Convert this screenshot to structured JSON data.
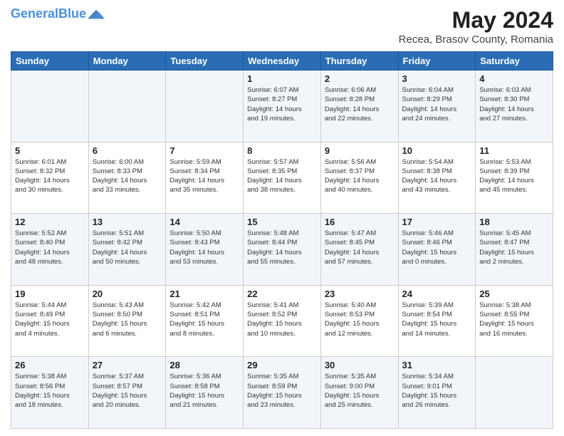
{
  "header": {
    "logo_line1": "General",
    "logo_line2": "Blue",
    "title": "May 2024",
    "subtitle": "Recea, Brasov County, Romania"
  },
  "days_of_week": [
    "Sunday",
    "Monday",
    "Tuesday",
    "Wednesday",
    "Thursday",
    "Friday",
    "Saturday"
  ],
  "weeks": [
    [
      {
        "day": "",
        "info": ""
      },
      {
        "day": "",
        "info": ""
      },
      {
        "day": "",
        "info": ""
      },
      {
        "day": "1",
        "info": "Sunrise: 6:07 AM\nSunset: 8:27 PM\nDaylight: 14 hours\nand 19 minutes."
      },
      {
        "day": "2",
        "info": "Sunrise: 6:06 AM\nSunset: 8:28 PM\nDaylight: 14 hours\nand 22 minutes."
      },
      {
        "day": "3",
        "info": "Sunrise: 6:04 AM\nSunset: 8:29 PM\nDaylight: 14 hours\nand 24 minutes."
      },
      {
        "day": "4",
        "info": "Sunrise: 6:03 AM\nSunset: 8:30 PM\nDaylight: 14 hours\nand 27 minutes."
      }
    ],
    [
      {
        "day": "5",
        "info": "Sunrise: 6:01 AM\nSunset: 8:32 PM\nDaylight: 14 hours\nand 30 minutes."
      },
      {
        "day": "6",
        "info": "Sunrise: 6:00 AM\nSunset: 8:33 PM\nDaylight: 14 hours\nand 33 minutes."
      },
      {
        "day": "7",
        "info": "Sunrise: 5:59 AM\nSunset: 8:34 PM\nDaylight: 14 hours\nand 35 minutes."
      },
      {
        "day": "8",
        "info": "Sunrise: 5:57 AM\nSunset: 8:35 PM\nDaylight: 14 hours\nand 38 minutes."
      },
      {
        "day": "9",
        "info": "Sunrise: 5:56 AM\nSunset: 8:37 PM\nDaylight: 14 hours\nand 40 minutes."
      },
      {
        "day": "10",
        "info": "Sunrise: 5:54 AM\nSunset: 8:38 PM\nDaylight: 14 hours\nand 43 minutes."
      },
      {
        "day": "11",
        "info": "Sunrise: 5:53 AM\nSunset: 8:39 PM\nDaylight: 14 hours\nand 45 minutes."
      }
    ],
    [
      {
        "day": "12",
        "info": "Sunrise: 5:52 AM\nSunset: 8:40 PM\nDaylight: 14 hours\nand 48 minutes."
      },
      {
        "day": "13",
        "info": "Sunrise: 5:51 AM\nSunset: 8:42 PM\nDaylight: 14 hours\nand 50 minutes."
      },
      {
        "day": "14",
        "info": "Sunrise: 5:50 AM\nSunset: 8:43 PM\nDaylight: 14 hours\nand 53 minutes."
      },
      {
        "day": "15",
        "info": "Sunrise: 5:48 AM\nSunset: 8:44 PM\nDaylight: 14 hours\nand 55 minutes."
      },
      {
        "day": "16",
        "info": "Sunrise: 5:47 AM\nSunset: 8:45 PM\nDaylight: 14 hours\nand 57 minutes."
      },
      {
        "day": "17",
        "info": "Sunrise: 5:46 AM\nSunset: 8:46 PM\nDaylight: 15 hours\nand 0 minutes."
      },
      {
        "day": "18",
        "info": "Sunrise: 5:45 AM\nSunset: 8:47 PM\nDaylight: 15 hours\nand 2 minutes."
      }
    ],
    [
      {
        "day": "19",
        "info": "Sunrise: 5:44 AM\nSunset: 8:49 PM\nDaylight: 15 hours\nand 4 minutes."
      },
      {
        "day": "20",
        "info": "Sunrise: 5:43 AM\nSunset: 8:50 PM\nDaylight: 15 hours\nand 6 minutes."
      },
      {
        "day": "21",
        "info": "Sunrise: 5:42 AM\nSunset: 8:51 PM\nDaylight: 15 hours\nand 8 minutes."
      },
      {
        "day": "22",
        "info": "Sunrise: 5:41 AM\nSunset: 8:52 PM\nDaylight: 15 hours\nand 10 minutes."
      },
      {
        "day": "23",
        "info": "Sunrise: 5:40 AM\nSunset: 8:53 PM\nDaylight: 15 hours\nand 12 minutes."
      },
      {
        "day": "24",
        "info": "Sunrise: 5:39 AM\nSunset: 8:54 PM\nDaylight: 15 hours\nand 14 minutes."
      },
      {
        "day": "25",
        "info": "Sunrise: 5:38 AM\nSunset: 8:55 PM\nDaylight: 15 hours\nand 16 minutes."
      }
    ],
    [
      {
        "day": "26",
        "info": "Sunrise: 5:38 AM\nSunset: 8:56 PM\nDaylight: 15 hours\nand 18 minutes."
      },
      {
        "day": "27",
        "info": "Sunrise: 5:37 AM\nSunset: 8:57 PM\nDaylight: 15 hours\nand 20 minutes."
      },
      {
        "day": "28",
        "info": "Sunrise: 5:36 AM\nSunset: 8:58 PM\nDaylight: 15 hours\nand 21 minutes."
      },
      {
        "day": "29",
        "info": "Sunrise: 5:35 AM\nSunset: 8:59 PM\nDaylight: 15 hours\nand 23 minutes."
      },
      {
        "day": "30",
        "info": "Sunrise: 5:35 AM\nSunset: 9:00 PM\nDaylight: 15 hours\nand 25 minutes."
      },
      {
        "day": "31",
        "info": "Sunrise: 5:34 AM\nSunset: 9:01 PM\nDaylight: 15 hours\nand 26 minutes."
      },
      {
        "day": "",
        "info": ""
      }
    ]
  ]
}
